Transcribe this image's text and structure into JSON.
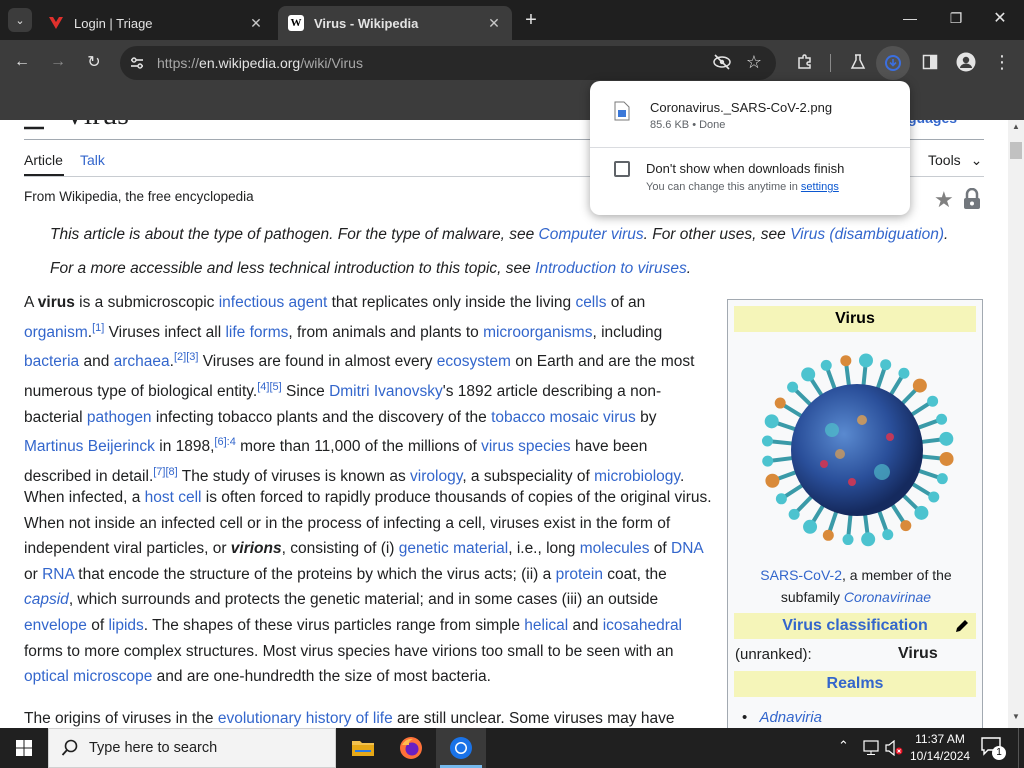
{
  "tabs": [
    {
      "title": "Login | Triage",
      "favicon": "triage-logo-icon"
    },
    {
      "title": "Virus - Wikipedia",
      "favicon": "wikipedia-logo-icon"
    }
  ],
  "toolbar": {
    "url_scheme": "https://",
    "url_host": "en.wikipedia.org",
    "url_path": "/wiki/Virus"
  },
  "downloads": {
    "filename": "Coronavirus._SARS-CoV-2.png",
    "meta": "85.6 KB • Done",
    "checkbox_label": "Don't show when downloads finish",
    "hint_prefix": "You can change this anytime in ",
    "hint_link": "settings"
  },
  "article": {
    "title_partial": "Virus",
    "tab_article": "Article",
    "tab_talk": "Talk",
    "tools": "Tools",
    "languages_partial": "guages",
    "tagline": "From Wikipedia, the free encyclopedia",
    "hatnote1": {
      "p1": "This article is about the type of pathogen. For the type of malware, see ",
      "l1": "Computer virus",
      "p2": ". For other uses, see ",
      "l2": "Virus (disambiguation)",
      "p3": "."
    },
    "hatnote2": {
      "p1": "For a more accessible and less technical introduction to this topic, see ",
      "l1": "Introduction to viruses",
      "p2": "."
    },
    "para1": [
      {
        "t": "A "
      },
      {
        "t": "virus",
        "b": true
      },
      {
        "t": " is a submicroscopic "
      },
      {
        "t": "infectious agent",
        "a": true
      },
      {
        "t": " that replicates only inside the living "
      },
      {
        "t": "cells",
        "a": true
      },
      {
        "t": " of an "
      },
      {
        "t": "organism",
        "a": true
      },
      {
        "t": "."
      },
      {
        "t": "[1]",
        "s": true
      },
      {
        "t": " Viruses infect all "
      },
      {
        "t": "life forms",
        "a": true
      },
      {
        "t": ", from animals and plants to "
      },
      {
        "t": "microorganisms",
        "a": true
      },
      {
        "t": ", including "
      },
      {
        "t": "bacteria",
        "a": true
      },
      {
        "t": " and "
      },
      {
        "t": "archaea",
        "a": true
      },
      {
        "t": "."
      },
      {
        "t": "[2][3]",
        "s": true
      },
      {
        "t": " Viruses are found in almost every "
      },
      {
        "t": "ecosystem",
        "a": true
      },
      {
        "t": " on Earth and are the most numerous type of biological entity."
      },
      {
        "t": "[4][5]",
        "s": true
      },
      {
        "t": " Since "
      },
      {
        "t": "Dmitri Ivanovsky",
        "a": true
      },
      {
        "t": "'s 1892 article describing a non-bacterial "
      },
      {
        "t": "pathogen",
        "a": true
      },
      {
        "t": " infecting tobacco plants and the discovery of the "
      },
      {
        "t": "tobacco mosaic virus",
        "a": true
      },
      {
        "t": " by "
      },
      {
        "t": "Martinus Beijerinck",
        "a": true
      },
      {
        "t": " in 1898,"
      },
      {
        "t": "[6]:4",
        "s": true
      },
      {
        "t": " more than 11,000 of the millions of "
      },
      {
        "t": "virus species",
        "a": true
      },
      {
        "t": " have been described in detail."
      },
      {
        "t": "[7][8]",
        "s": true
      },
      {
        "t": " The study of viruses is known as "
      },
      {
        "t": "virology",
        "a": true
      },
      {
        "t": ", a subspeciality of "
      },
      {
        "t": "microbiology",
        "a": true
      },
      {
        "t": "."
      }
    ],
    "para2": [
      {
        "t": "When infected, a "
      },
      {
        "t": "host cell",
        "a": true
      },
      {
        "t": " is often forced to rapidly produce thousands of copies of the original virus. When not inside an infected cell or in the process of infecting a cell, viruses exist in the form of independent viral particles, or "
      },
      {
        "t": "virions",
        "bi": true
      },
      {
        "t": ", consisting of (i) "
      },
      {
        "t": "genetic material",
        "a": true
      },
      {
        "t": ", i.e., long "
      },
      {
        "t": "molecules",
        "a": true
      },
      {
        "t": " of "
      },
      {
        "t": "DNA",
        "a": true
      },
      {
        "t": " or "
      },
      {
        "t": "RNA",
        "a": true
      },
      {
        "t": " that encode the structure of the proteins by which the virus acts; (ii) a "
      },
      {
        "t": "protein",
        "a": true
      },
      {
        "t": " coat, the "
      },
      {
        "t": "capsid",
        "ai": true
      },
      {
        "t": ", which surrounds and protects the genetic material; and in some cases (iii) an outside "
      },
      {
        "t": "envelope",
        "a": true
      },
      {
        "t": " of "
      },
      {
        "t": "lipids",
        "a": true
      },
      {
        "t": ". The shapes of these virus particles range from simple "
      },
      {
        "t": "helical",
        "a": true
      },
      {
        "t": " and "
      },
      {
        "t": "icosahedral",
        "a": true
      },
      {
        "t": " forms to more complex structures. Most virus species have virions too small to be seen with an "
      },
      {
        "t": "optical microscope",
        "a": true
      },
      {
        "t": " and are one-hundredth the size of most bacteria."
      }
    ],
    "para3_partial": [
      {
        "t": "The origins of viruses in the "
      },
      {
        "t": "evolutionary history of life",
        "a": true
      },
      {
        "t": " are still unclear. Some viruses may have"
      }
    ]
  },
  "infobox": {
    "title": "Virus",
    "caption_link": "SARS-CoV-2",
    "caption_text": ", a member of the subfamily ",
    "caption_italic_link": "Coronavirinae",
    "classification_header": "Virus classification",
    "unranked_label": "(unranked):",
    "unranked_value": "Virus",
    "realms_header": "Realms",
    "realm_first": "Adnaviria"
  },
  "taskbar": {
    "search_placeholder": "Type here to search",
    "time": "11:37 AM",
    "date": "10/14/2024",
    "notif_count": "1"
  }
}
